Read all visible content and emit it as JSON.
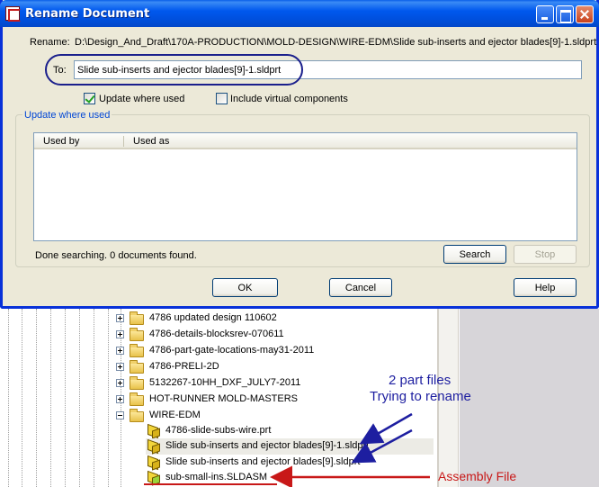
{
  "dialog": {
    "title": "Rename Document",
    "rename_label": "Rename:",
    "rename_path": "D:\\Design_And_Draft\\170A-PRODUCTION\\MOLD-DESIGN\\WIRE-EDM\\Slide sub-inserts and ejector blades[9]-1.sldprt",
    "to_label": "To:",
    "to_value": "Slide sub-inserts and ejector blades[9]-1.sldprt",
    "update_where_used_checkbox": {
      "label": "Update where used",
      "checked": true
    },
    "include_virtual_checkbox": {
      "label": "Include virtual components",
      "checked": false
    },
    "group_title": "Update where used",
    "list_columns": [
      "Used by",
      "Used as"
    ],
    "status": "Done searching.  0 documents found.",
    "buttons": {
      "search": "Search",
      "stop": "Stop",
      "ok": "OK",
      "cancel": "Cancel",
      "help": "Help"
    }
  },
  "tree": {
    "items": [
      {
        "label": "4786 updated design 110602",
        "type": "folder",
        "expander": "plus"
      },
      {
        "label": "4786-details-blocksrev-070611",
        "type": "folder",
        "expander": "plus"
      },
      {
        "label": "4786-part-gate-locations-may31-2011",
        "type": "folder",
        "expander": "plus"
      },
      {
        "label": "4786-PRELI-2D",
        "type": "folder",
        "expander": "plus"
      },
      {
        "label": "5132267-10HH_DXF_JULY7-2011",
        "type": "folder",
        "expander": "plus"
      },
      {
        "label": "HOT-RUNNER MOLD-MASTERS",
        "type": "folder",
        "expander": "plus"
      },
      {
        "label": "WIRE-EDM",
        "type": "folder",
        "expander": "minus"
      },
      {
        "label": "4786-slide-subs-wire.prt",
        "type": "part"
      },
      {
        "label": "Slide sub-inserts and ejector blades[9]-1.sldprt",
        "type": "part"
      },
      {
        "label": "Slide sub-inserts and ejector blades[9].sldprt",
        "type": "part"
      },
      {
        "label": "sub-small-ins.SLDASM",
        "type": "assembly"
      }
    ]
  },
  "annotations": {
    "blue_line1": "2 part files",
    "blue_line2": "Trying to rename",
    "red": "Assembly File"
  },
  "colors": {
    "title_bar": "#0058ee",
    "dialog_bg": "#ece9d8",
    "group_title": "#0046d5",
    "annotation_blue": "#1d1ea0",
    "annotation_red": "#c81818"
  }
}
